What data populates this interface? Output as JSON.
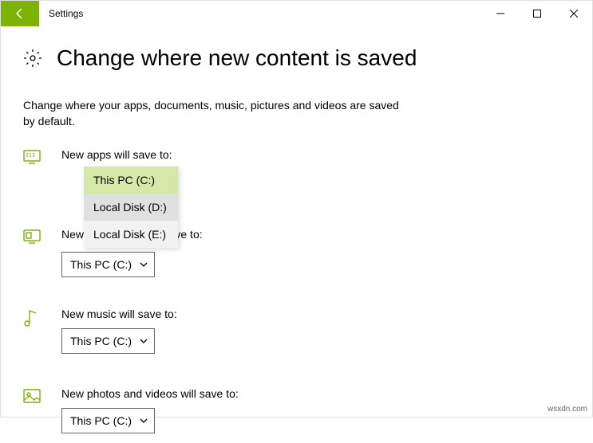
{
  "window": {
    "title": "Settings"
  },
  "header": {
    "page_title": "Change where new content is saved",
    "subtitle": "Change where your apps, documents, music, pictures and videos are saved by default."
  },
  "sections": {
    "apps": {
      "label": "New apps will save to:",
      "value": "This PC (C:)"
    },
    "documents": {
      "label": "New documents will save to:",
      "value": "This PC (C:)"
    },
    "music": {
      "label": "New music will save to:",
      "value": "This PC (C:)"
    },
    "photos": {
      "label": "New photos and videos will save to:",
      "value": "This PC (C:)"
    }
  },
  "dropdown": {
    "options": [
      "This PC (C:)",
      "Local Disk (D:)",
      "Local Disk (E:)"
    ]
  },
  "watermark": "wsxdn.com"
}
